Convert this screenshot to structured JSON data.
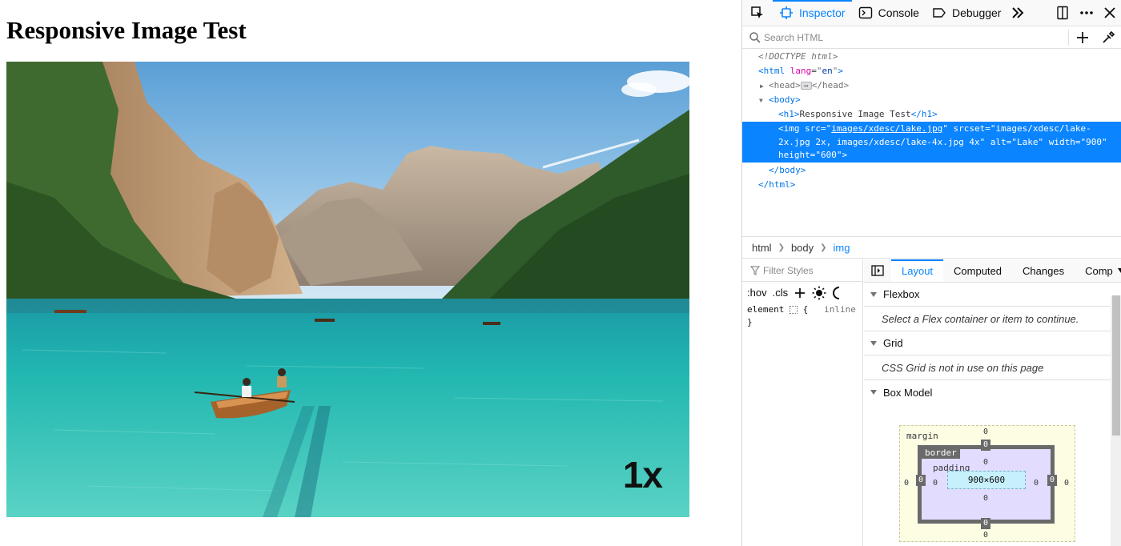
{
  "page": {
    "heading": "Responsive Image Test",
    "image_badge": "1x",
    "image_alt": "Lake"
  },
  "devtools": {
    "tabs": [
      {
        "label": "Inspector",
        "icon": "inspector-icon",
        "active": true
      },
      {
        "label": "Console",
        "icon": "console-icon",
        "active": false
      },
      {
        "label": "Debugger",
        "icon": "debugger-icon",
        "active": false
      }
    ],
    "search_placeholder": "Search HTML",
    "markup": {
      "doctype": "<!DOCTYPE html>",
      "html_tag": "html",
      "html_attr": "lang",
      "html_val": "en",
      "head": "head",
      "body": "body",
      "h1_text": "Responsive Image Test",
      "img_line1_pre": "<img src=\"",
      "img_src": "images/xdesc/lake.jpg",
      "img_line1_post": "\" srcset=\"images/xdesc/lake-",
      "img_line2": "2x.jpg 2x, images/xdesc/lake-4x.jpg 4x\" alt=\"Lake\" width=\"900\"",
      "img_line3": "height=\"600\">",
      "close_body": "</body>",
      "close_html": "</html>"
    },
    "breadcrumbs": [
      "html",
      "body",
      "img"
    ],
    "rules": {
      "filter_placeholder": "Filter Styles",
      "hov": ":hov",
      "cls": ".cls",
      "element_open": "element ",
      "element_brace": "{",
      "inline_label": "inline",
      "element_close": "}"
    },
    "sidebar_tabs": [
      {
        "label": "Layout",
        "active": true
      },
      {
        "label": "Computed",
        "active": false
      },
      {
        "label": "Changes",
        "active": false
      },
      {
        "label": "Comp",
        "active": false
      }
    ],
    "flexbox": {
      "title": "Flexbox",
      "message": "Select a Flex container or item to continue."
    },
    "grid": {
      "title": "Grid",
      "message": "CSS Grid is not in use on this page"
    },
    "box_model": {
      "title": "Box Model",
      "margin_label": "margin",
      "border_label": "border",
      "padding_label": "padding",
      "content_size": "900×600",
      "zero": "0"
    }
  },
  "colors": {
    "accent": "#0a84ff",
    "selection": "#0a84ff",
    "lake": "#1fb8b4"
  }
}
